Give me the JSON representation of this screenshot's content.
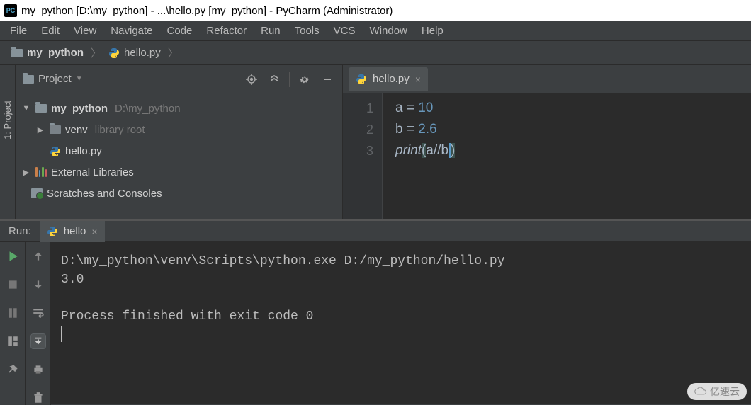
{
  "title": "my_python [D:\\my_python] - ...\\hello.py [my_python] - PyCharm (Administrator)",
  "app_icon": "PC",
  "menu": [
    "File",
    "Edit",
    "View",
    "Navigate",
    "Code",
    "Refactor",
    "Run",
    "Tools",
    "VCS",
    "Window",
    "Help"
  ],
  "menu_accel": [
    0,
    0,
    0,
    0,
    0,
    0,
    0,
    0,
    2,
    0,
    0
  ],
  "breadcrumb": {
    "project": "my_python",
    "file": "hello.py"
  },
  "sidebar_tab": "1: Project",
  "project_panel": {
    "title": "Project",
    "root": {
      "name": "my_python",
      "path": "D:\\my_python"
    },
    "venv": {
      "name": "venv",
      "note": "library root"
    },
    "file": "hello.py",
    "external": "External Libraries",
    "scratches": "Scratches and Consoles"
  },
  "editor": {
    "tab_name": "hello.py",
    "gutter": [
      "1",
      "2",
      "3"
    ],
    "lines": [
      {
        "var": "a",
        "op": " = ",
        "num": "10"
      },
      {
        "var": "b",
        "op": " = ",
        "num": "2.6"
      }
    ],
    "line3": {
      "fn": "print",
      "open": "(",
      "a": "a",
      "sl": "//",
      "b": "b",
      "close": ")"
    }
  },
  "run": {
    "label": "Run:",
    "tab": "hello",
    "console": {
      "cmd": "D:\\my_python\\venv\\Scripts\\python.exe D:/my_python/hello.py",
      "out": "3.0",
      "exit": "Process finished with exit code 0"
    }
  },
  "watermark": "亿速云"
}
